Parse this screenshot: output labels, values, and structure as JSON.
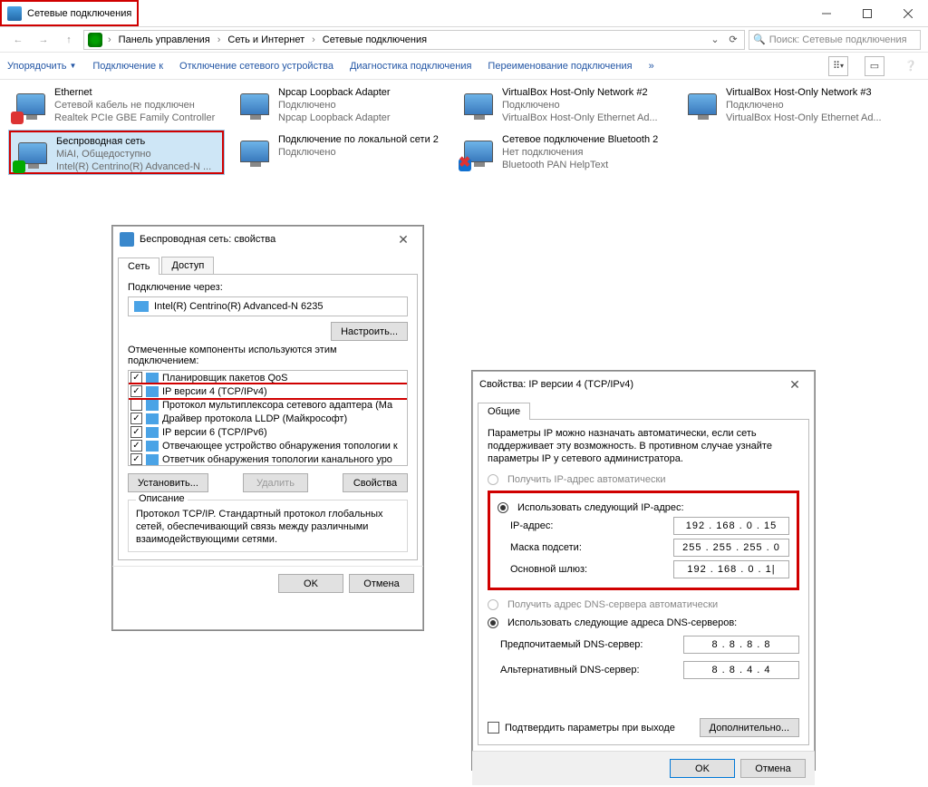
{
  "titlebar": {
    "title": "Сетевые подключения"
  },
  "breadcrumb": {
    "items": [
      "Панель управления",
      "Сеть и Интернет",
      "Сетевые подключения"
    ]
  },
  "search": {
    "placeholder": "Поиск: Сетевые подключения"
  },
  "toolbar": {
    "organize": "Упорядочить",
    "connect_to": "Подключение к",
    "disable": "Отключение сетевого устройства",
    "diagnose": "Диагностика подключения",
    "rename": "Переименование подключения"
  },
  "connections": [
    {
      "name": "Ethernet",
      "status": "Сетевой кабель не подключен",
      "device": "Realtek PCIe GBE Family Controller",
      "badge": "red"
    },
    {
      "name": "Npcap Loopback Adapter",
      "status": "Подключено",
      "device": "Npcap Loopback Adapter",
      "badge": ""
    },
    {
      "name": "VirtualBox Host-Only Network #2",
      "status": "Подключено",
      "device": "VirtualBox Host-Only Ethernet Ad...",
      "badge": ""
    },
    {
      "name": "VirtualBox Host-Only Network #3",
      "status": "Подключено",
      "device": "VirtualBox Host-Only Ethernet Ad...",
      "badge": ""
    },
    {
      "name": "Беспроводная сеть",
      "status": "MiAI, Общедоступно",
      "device": "Intel(R) Centrino(R) Advanced-N ...",
      "badge": "bars",
      "selected": true
    },
    {
      "name": "Подключение по локальной сети 2",
      "status": "Подключено",
      "device": "",
      "badge": ""
    },
    {
      "name": "Сетевое подключение Bluetooth 2",
      "status": "Нет подключения",
      "device": "Bluetooth PAN HelpText",
      "badge": "bt",
      "redx": true
    }
  ],
  "dlg1": {
    "title": "Беспроводная сеть: свойства",
    "tabs": {
      "network": "Сеть",
      "access": "Доступ"
    },
    "connect_through_label": "Подключение через:",
    "adapter": "Intel(R) Centrino(R) Advanced-N 6235",
    "configure_btn": "Настроить...",
    "components_label": "Отмеченные компоненты используются этим подключением:",
    "components": [
      {
        "checked": true,
        "label": "Планировщик пакетов QoS"
      },
      {
        "checked": true,
        "label": "IP версии 4 (TCP/IPv4)",
        "hl": true
      },
      {
        "checked": false,
        "label": "Протокол мультиплексора сетевого адаптера (Ма"
      },
      {
        "checked": true,
        "label": "Драйвер протокола LLDP (Майкрософт)"
      },
      {
        "checked": true,
        "label": "IP версии 6 (TCP/IPv6)"
      },
      {
        "checked": true,
        "label": "Отвечающее устройство обнаружения топологии к"
      },
      {
        "checked": true,
        "label": "Ответчик обнаружения топологии канального уро"
      }
    ],
    "install_btn": "Установить...",
    "uninstall_btn": "Удалить",
    "props_btn": "Свойства",
    "desc_label": "Описание",
    "desc_text": "Протокол TCP/IP. Стандартный протокол глобальных сетей, обеспечивающий связь между различными взаимодействующими сетями.",
    "ok": "OK",
    "cancel": "Отмена"
  },
  "dlg2": {
    "title": "Свойства: IP версии 4 (TCP/IPv4)",
    "tab": "Общие",
    "info": "Параметры IP можно назначать автоматически, если сеть поддерживает эту возможность. В противном случае узнайте параметры IP у сетевого администратора.",
    "auto_ip": "Получить IP-адрес автоматически",
    "use_ip": "Использовать следующий IP-адрес:",
    "ip_label": "IP-адрес:",
    "ip_value": "192 . 168 .   0  .  15",
    "mask_label": "Маска подсети:",
    "mask_value": "255 . 255 . 255 .   0",
    "gw_label": "Основной шлюз:",
    "gw_value": "192 . 168 .   0  .   1|",
    "auto_dns": "Получить адрес DNS-сервера автоматически",
    "use_dns": "Использовать следующие адреса DNS-серверов:",
    "dns1_label": "Предпочитаемый DNS-сервер:",
    "dns1_value": "8  .  8  .  8  .  8",
    "dns2_label": "Альтернативный DNS-сервер:",
    "dns2_value": "8  .  8  .  4  .  4",
    "confirm_exit": "Подтвердить параметры при выходе",
    "advanced": "Дополнительно...",
    "ok": "OK",
    "cancel": "Отмена"
  }
}
